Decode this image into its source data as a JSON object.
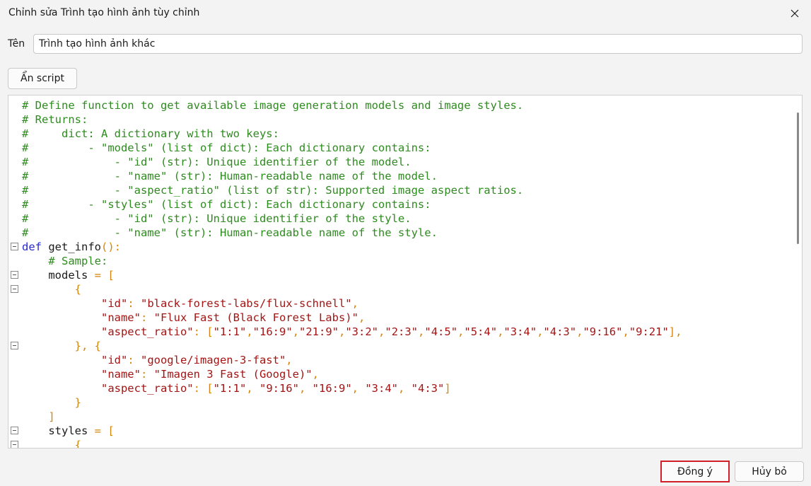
{
  "window": {
    "title": "Chỉnh sửa Trình tạo hình ảnh tùy chỉnh",
    "close_icon": "close-icon"
  },
  "form": {
    "name_label": "Tên",
    "name_value": "Trình tạo hình ảnh khác",
    "hide_script_label": "Ẩn script"
  },
  "editor": {
    "lines": [
      {
        "fold": false,
        "tokens": [
          {
            "t": "# Define function to get available image generation models and image styles.",
            "c": "comment"
          }
        ]
      },
      {
        "fold": false,
        "tokens": [
          {
            "t": "# Returns:",
            "c": "comment"
          }
        ]
      },
      {
        "fold": false,
        "tokens": [
          {
            "t": "#     dict: A dictionary with two keys:",
            "c": "comment"
          }
        ]
      },
      {
        "fold": false,
        "tokens": [
          {
            "t": "#         - \"models\" (list of dict): Each dictionary contains:",
            "c": "comment"
          }
        ]
      },
      {
        "fold": false,
        "tokens": [
          {
            "t": "#             - \"id\" (str): Unique identifier of the model.",
            "c": "comment"
          }
        ]
      },
      {
        "fold": false,
        "tokens": [
          {
            "t": "#             - \"name\" (str): Human-readable name of the model.",
            "c": "comment"
          }
        ]
      },
      {
        "fold": false,
        "tokens": [
          {
            "t": "#             - \"aspect_ratio\" (list of str): Supported image aspect ratios.",
            "c": "comment"
          }
        ]
      },
      {
        "fold": false,
        "tokens": [
          {
            "t": "#         - \"styles\" (list of dict): Each dictionary contains:",
            "c": "comment"
          }
        ]
      },
      {
        "fold": false,
        "tokens": [
          {
            "t": "#             - \"id\" (str): Unique identifier of the style.",
            "c": "comment"
          }
        ]
      },
      {
        "fold": false,
        "tokens": [
          {
            "t": "#             - \"name\" (str): Human-readable name of the style.",
            "c": "comment"
          }
        ]
      },
      {
        "fold": true,
        "tokens": [
          {
            "t": "def",
            "c": "keyword"
          },
          {
            "t": " get_info",
            "c": "plain"
          },
          {
            "t": "():",
            "c": "punct"
          }
        ]
      },
      {
        "fold": false,
        "tokens": [
          {
            "t": "    ",
            "c": "plain"
          },
          {
            "t": "# Sample:",
            "c": "comment"
          }
        ]
      },
      {
        "fold": true,
        "tokens": [
          {
            "t": "    models ",
            "c": "plain"
          },
          {
            "t": "= [",
            "c": "punct"
          }
        ]
      },
      {
        "fold": true,
        "tokens": [
          {
            "t": "        ",
            "c": "plain"
          },
          {
            "t": "{",
            "c": "punct"
          }
        ]
      },
      {
        "fold": false,
        "tokens": [
          {
            "t": "            ",
            "c": "plain"
          },
          {
            "t": "\"id\"",
            "c": "string"
          },
          {
            "t": ": ",
            "c": "punct"
          },
          {
            "t": "\"black-forest-labs/flux-schnell\"",
            "c": "string"
          },
          {
            "t": ",",
            "c": "punct"
          }
        ]
      },
      {
        "fold": false,
        "tokens": [
          {
            "t": "            ",
            "c": "plain"
          },
          {
            "t": "\"name\"",
            "c": "string"
          },
          {
            "t": ": ",
            "c": "punct"
          },
          {
            "t": "\"Flux Fast (Black Forest Labs)\"",
            "c": "string"
          },
          {
            "t": ",",
            "c": "punct"
          }
        ]
      },
      {
        "fold": false,
        "tokens": [
          {
            "t": "            ",
            "c": "plain"
          },
          {
            "t": "\"aspect_ratio\"",
            "c": "string"
          },
          {
            "t": ": [",
            "c": "punct"
          },
          {
            "t": "\"1:1\"",
            "c": "string"
          },
          {
            "t": ",",
            "c": "punct"
          },
          {
            "t": "\"16:9\"",
            "c": "string"
          },
          {
            "t": ",",
            "c": "punct"
          },
          {
            "t": "\"21:9\"",
            "c": "string"
          },
          {
            "t": ",",
            "c": "punct"
          },
          {
            "t": "\"3:2\"",
            "c": "string"
          },
          {
            "t": ",",
            "c": "punct"
          },
          {
            "t": "\"2:3\"",
            "c": "string"
          },
          {
            "t": ",",
            "c": "punct"
          },
          {
            "t": "\"4:5\"",
            "c": "string"
          },
          {
            "t": ",",
            "c": "punct"
          },
          {
            "t": "\"5:4\"",
            "c": "string"
          },
          {
            "t": ",",
            "c": "punct"
          },
          {
            "t": "\"3:4\"",
            "c": "string"
          },
          {
            "t": ",",
            "c": "punct"
          },
          {
            "t": "\"4:3\"",
            "c": "string"
          },
          {
            "t": ",",
            "c": "punct"
          },
          {
            "t": "\"9:16\"",
            "c": "string"
          },
          {
            "t": ",",
            "c": "punct"
          },
          {
            "t": "\"9:21\"",
            "c": "string"
          },
          {
            "t": "],",
            "c": "punct"
          }
        ]
      },
      {
        "fold": true,
        "tokens": [
          {
            "t": "        ",
            "c": "plain"
          },
          {
            "t": "}, {",
            "c": "punct"
          }
        ]
      },
      {
        "fold": false,
        "tokens": [
          {
            "t": "            ",
            "c": "plain"
          },
          {
            "t": "\"id\"",
            "c": "string"
          },
          {
            "t": ": ",
            "c": "punct"
          },
          {
            "t": "\"google/imagen-3-fast\"",
            "c": "string"
          },
          {
            "t": ",",
            "c": "punct"
          }
        ]
      },
      {
        "fold": false,
        "tokens": [
          {
            "t": "            ",
            "c": "plain"
          },
          {
            "t": "\"name\"",
            "c": "string"
          },
          {
            "t": ": ",
            "c": "punct"
          },
          {
            "t": "\"Imagen 3 Fast (Google)\"",
            "c": "string"
          },
          {
            "t": ",",
            "c": "punct"
          }
        ]
      },
      {
        "fold": false,
        "tokens": [
          {
            "t": "            ",
            "c": "plain"
          },
          {
            "t": "\"aspect_ratio\"",
            "c": "string"
          },
          {
            "t": ": [",
            "c": "punct"
          },
          {
            "t": "\"1:1\"",
            "c": "string"
          },
          {
            "t": ", ",
            "c": "punct"
          },
          {
            "t": "\"9:16\"",
            "c": "string"
          },
          {
            "t": ", ",
            "c": "punct"
          },
          {
            "t": "\"16:9\"",
            "c": "string"
          },
          {
            "t": ", ",
            "c": "punct"
          },
          {
            "t": "\"3:4\"",
            "c": "string"
          },
          {
            "t": ", ",
            "c": "punct"
          },
          {
            "t": "\"4:3\"",
            "c": "string"
          },
          {
            "t": "]",
            "c": "punct"
          }
        ]
      },
      {
        "fold": false,
        "tokens": [
          {
            "t": "        ",
            "c": "plain"
          },
          {
            "t": "}",
            "c": "punct"
          }
        ]
      },
      {
        "fold": false,
        "tokens": [
          {
            "t": "    ",
            "c": "plain"
          },
          {
            "t": "]",
            "c": "punct"
          }
        ]
      },
      {
        "fold": true,
        "tokens": [
          {
            "t": "    styles ",
            "c": "plain"
          },
          {
            "t": "= [",
            "c": "punct"
          }
        ]
      },
      {
        "fold": true,
        "tokens": [
          {
            "t": "        ",
            "c": "plain"
          },
          {
            "t": "{",
            "c": "punct"
          }
        ]
      }
    ]
  },
  "footer": {
    "ok_label": "Đồng ý",
    "cancel_label": "Hủy bỏ"
  },
  "colors": {
    "comment": "#2e8b1f",
    "keyword": "#2a2ad0",
    "string": "#a31515",
    "punct": "#d4860b",
    "ok_border": "#d1202a"
  }
}
